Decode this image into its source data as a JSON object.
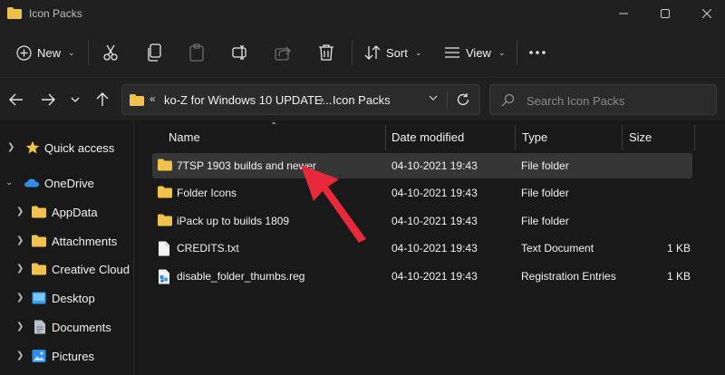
{
  "window": {
    "title": "Icon Packs"
  },
  "toolbar": {
    "new_label": "New",
    "sort_label": "Sort",
    "view_label": "View",
    "icons": [
      "cut-icon",
      "copy-icon",
      "paste-icon",
      "rename-icon",
      "share-icon",
      "delete-icon",
      "more-icon"
    ]
  },
  "address": {
    "overflow": "«",
    "crumbs": [
      "ko-Z for Windows 10 UPDATE...",
      "Icon Packs"
    ],
    "separator": "›"
  },
  "search": {
    "placeholder": "Search Icon Packs"
  },
  "sidebar": {
    "items": [
      {
        "label": "Quick access",
        "icon": "star-icon"
      },
      {
        "label": "OneDrive",
        "icon": "cloud-icon"
      },
      {
        "label": "AppData",
        "icon": "folder-icon"
      },
      {
        "label": "Attachments",
        "icon": "folder-icon"
      },
      {
        "label": "Creative Cloud",
        "icon": "folder-icon"
      },
      {
        "label": "Desktop",
        "icon": "desktop-icon"
      },
      {
        "label": "Documents",
        "icon": "documents-icon"
      },
      {
        "label": "Pictures",
        "icon": "pictures-icon"
      }
    ]
  },
  "columns": {
    "name": "Name",
    "date": "Date modified",
    "type": "Type",
    "size": "Size"
  },
  "files": [
    {
      "name": "7TSP 1903 builds and newer",
      "date": "04-10-2021 19:43",
      "type": "File folder",
      "size": "",
      "icon": "folder-icon",
      "selected": true
    },
    {
      "name": "Folder Icons",
      "date": "04-10-2021 19:43",
      "type": "File folder",
      "size": "",
      "icon": "folder-icon"
    },
    {
      "name": "iPack up to builds 1809",
      "date": "04-10-2021 19:43",
      "type": "File folder",
      "size": "",
      "icon": "folder-icon"
    },
    {
      "name": "CREDITS.txt",
      "date": "04-10-2021 19:43",
      "type": "Text Document",
      "size": "1 KB",
      "icon": "text-file-icon"
    },
    {
      "name": "disable_folder_thumbs.reg",
      "date": "04-10-2021 19:43",
      "type": "Registration Entries",
      "size": "1 KB",
      "icon": "registry-file-icon"
    }
  ],
  "colors": {
    "folder": "#f0c24b",
    "background": "#191919",
    "chrome": "#202020",
    "selected_row": "#363636",
    "annotation_arrow": "#e8293b",
    "onedrive": "#2f8ee8"
  }
}
